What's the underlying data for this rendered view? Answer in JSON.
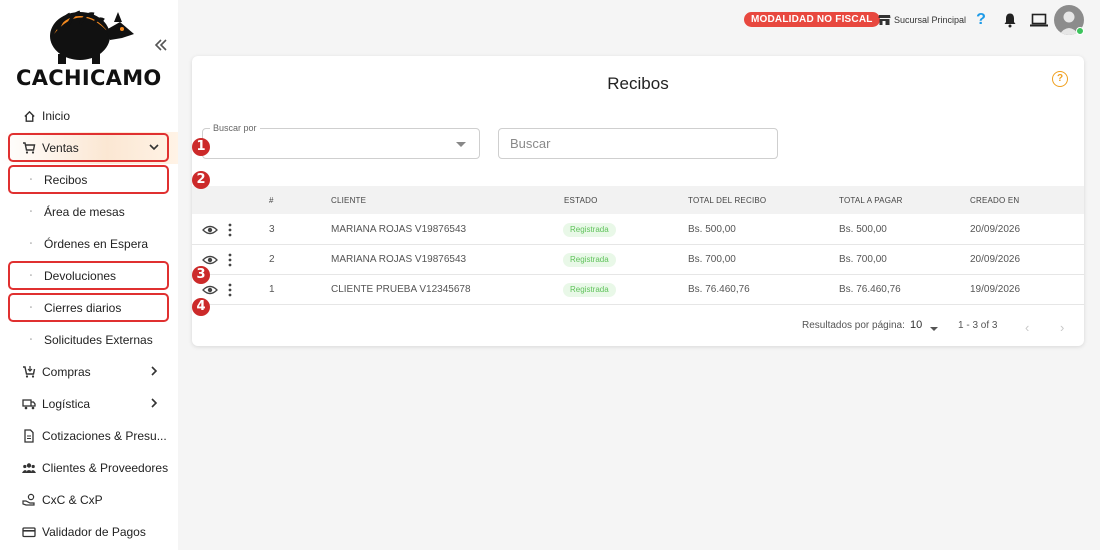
{
  "app": {
    "brand": "CACHICAMO"
  },
  "sidebar": {
    "items": [
      {
        "label": "Inicio",
        "icon": "home-icon"
      },
      {
        "label": "Ventas",
        "icon": "cart-icon",
        "expanded": true
      },
      {
        "label": "Recibos",
        "sub": true
      },
      {
        "label": "Área de mesas",
        "sub": true
      },
      {
        "label": "Órdenes en Espera",
        "sub": true
      },
      {
        "label": "Devoluciones",
        "sub": true
      },
      {
        "label": "Cierres diarios",
        "sub": true
      },
      {
        "label": "Solicitudes Externas",
        "sub": true
      },
      {
        "label": "Compras",
        "icon": "cart-download-icon"
      },
      {
        "label": "Logística",
        "icon": "truck-icon"
      },
      {
        "label": "Cotizaciones & Presu...",
        "icon": "document-icon"
      },
      {
        "label": "Clientes & Proveedores",
        "icon": "people-icon"
      },
      {
        "label": "CxC & CxP",
        "icon": "hand-money-icon"
      },
      {
        "label": "Validador de Pagos",
        "icon": "credit-card-icon"
      }
    ]
  },
  "topbar": {
    "mode_badge": "MODALIDAD NO FISCAL",
    "store": "Sucursal Principal",
    "help": "?",
    "colors": {
      "badge": "#e8483f",
      "help": "#1e9be8",
      "online": "#3cc35c"
    }
  },
  "main": {
    "title": "Recibos",
    "help": "?",
    "search_by_label": "Buscar por",
    "search_placeholder": "Buscar",
    "columns": [
      "#",
      "CLIENTE",
      "ESTADO",
      "TOTAL DEL RECIBO",
      "TOTAL A PAGAR",
      "CREADO EN"
    ],
    "rows": [
      {
        "num": "3",
        "client": "MARIANA ROJAS V19876543",
        "status": "Registrada",
        "total": "Bs. 500,00",
        "to_pay": "Bs. 500,00",
        "created": "20/09/2026"
      },
      {
        "num": "2",
        "client": "MARIANA ROJAS V19876543",
        "status": "Registrada",
        "total": "Bs. 700,00",
        "to_pay": "Bs. 700,00",
        "created": "20/09/2026"
      },
      {
        "num": "1",
        "client": "CLIENTE PRUEBA V12345678",
        "status": "Registrada",
        "total": "Bs. 76.460,76",
        "to_pay": "Bs. 76.460,76",
        "created": "19/09/2026"
      }
    ],
    "pagination": {
      "per_page_label": "Resultados por página:",
      "per_page": "10",
      "range": "1 - 3 of 3"
    }
  },
  "annotations": {
    "markers": [
      "1",
      "2",
      "3",
      "4"
    ],
    "color": "#cc2a2a"
  }
}
